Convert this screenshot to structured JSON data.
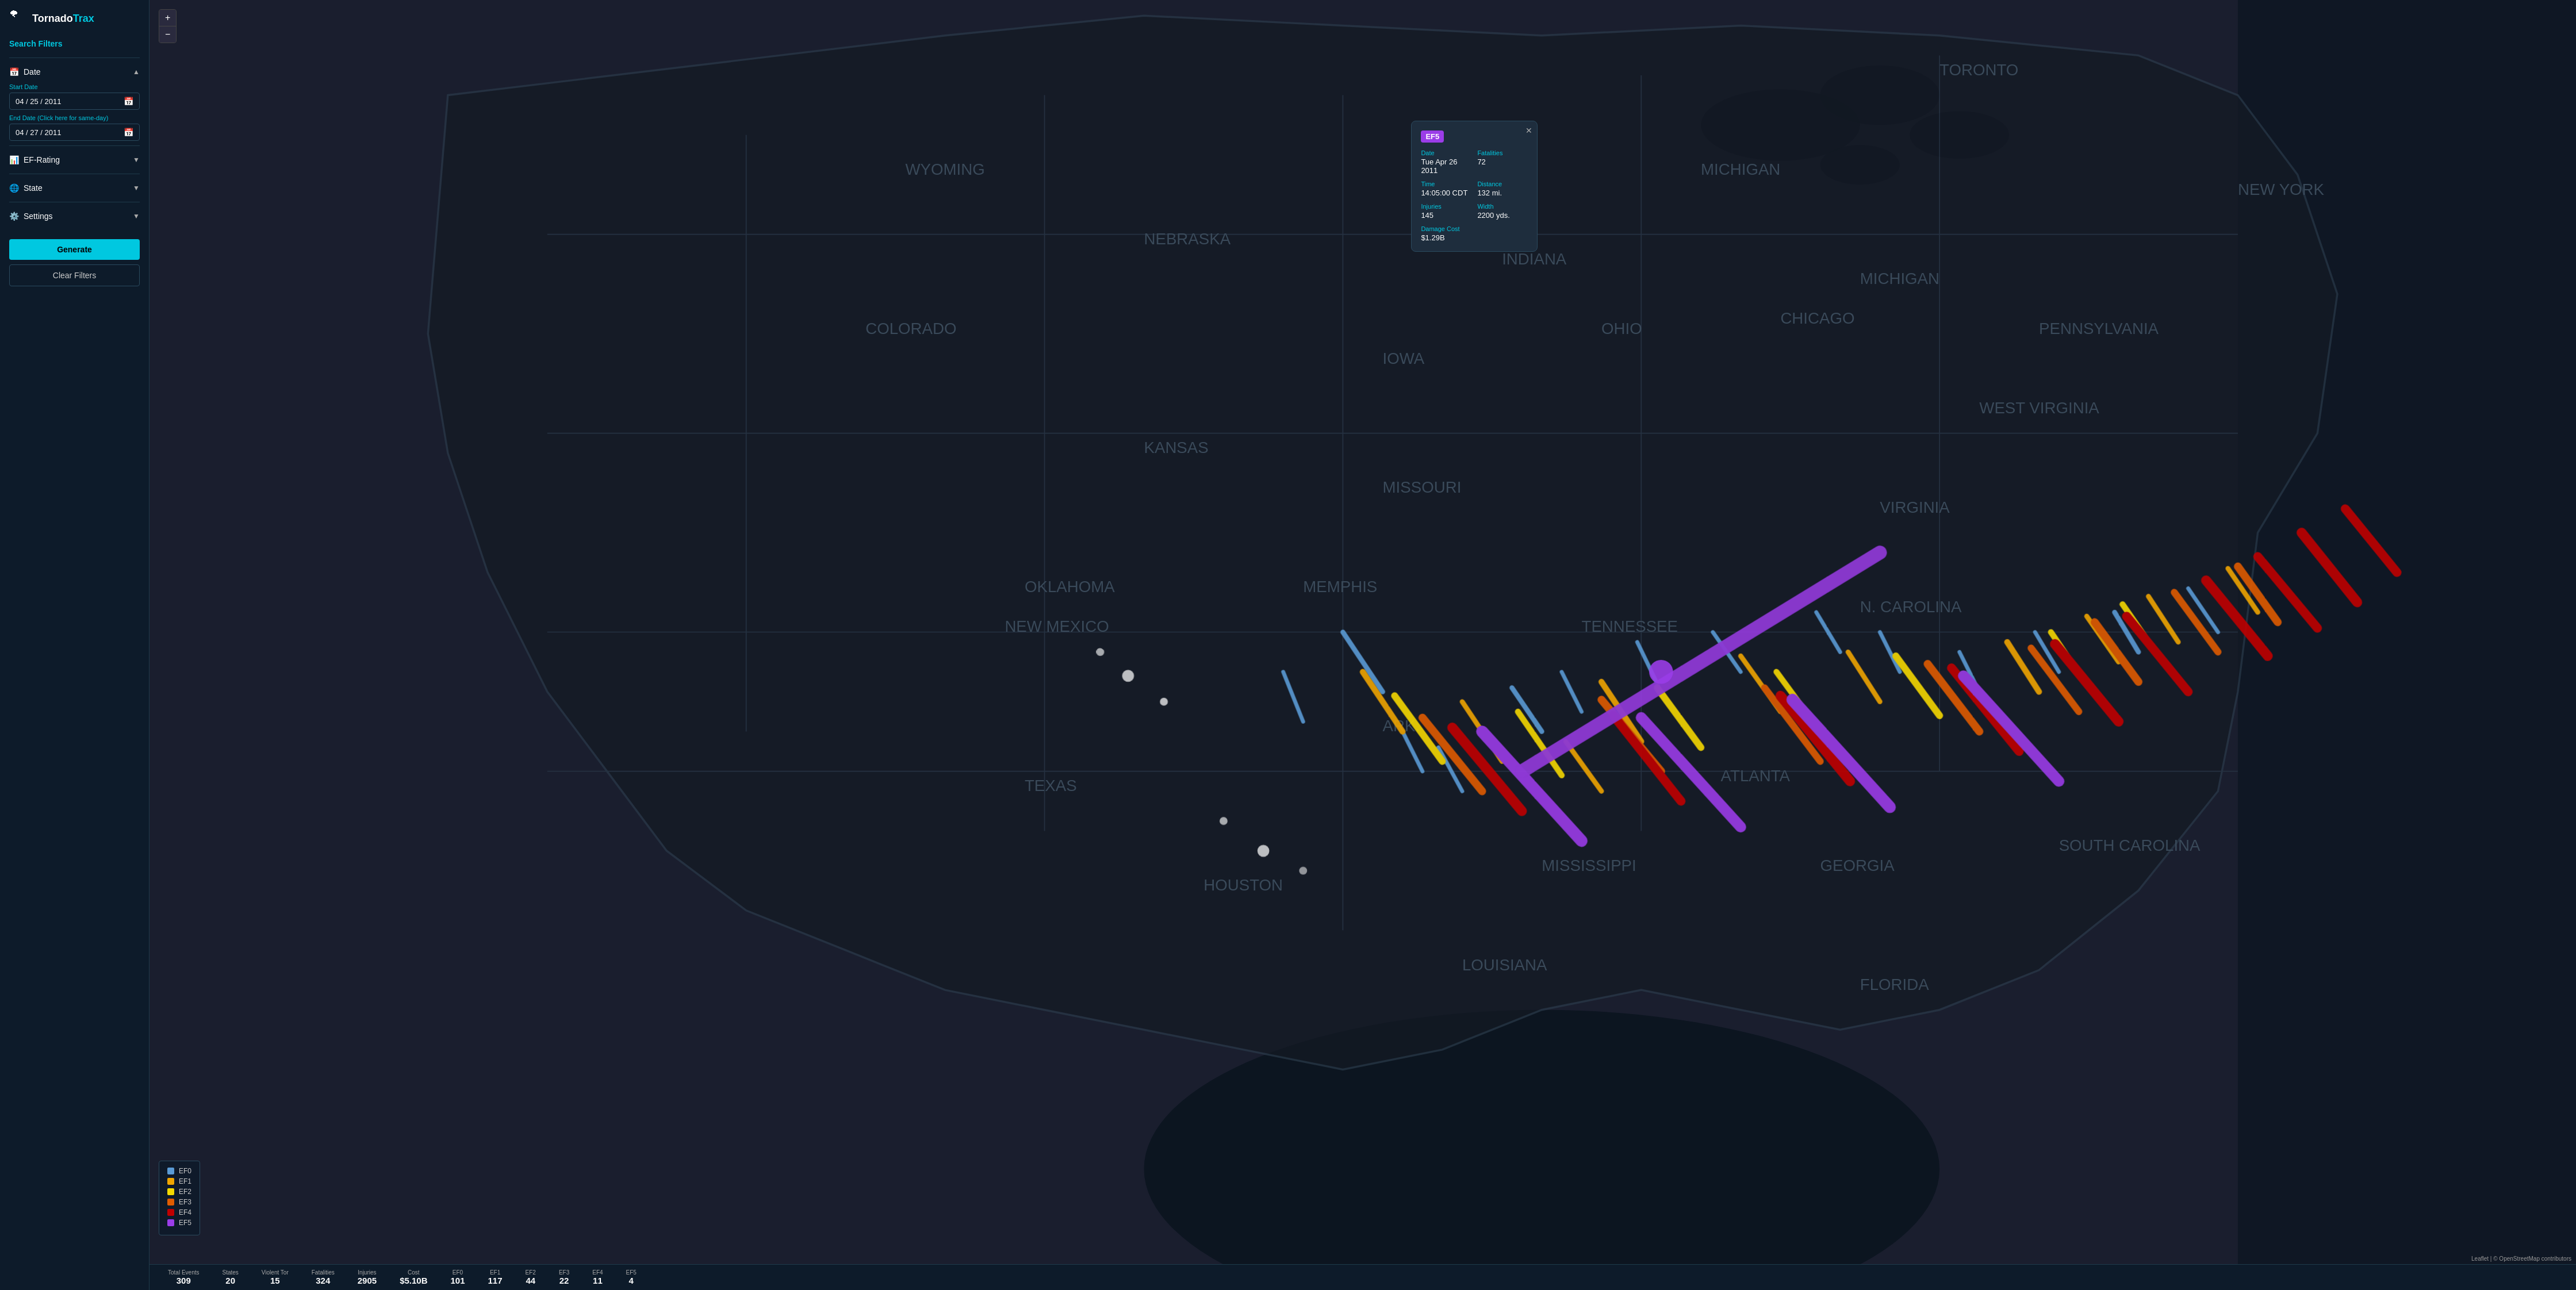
{
  "app": {
    "logo_tornado": "Tornado",
    "logo_trax": "Trax",
    "logo_icon": "🌪"
  },
  "sidebar": {
    "search_filters_title": "Search Filters",
    "date_section": {
      "label": "Date",
      "start_date_label": "Start Date",
      "start_date_value": "04 / 25 / 2011",
      "end_date_label": "End Date (Click here for same-day)",
      "end_date_value": "04 / 27 / 2011"
    },
    "ef_rating": {
      "label": "EF-Rating"
    },
    "state": {
      "label": "State"
    },
    "settings": {
      "label": "Settings"
    },
    "generate_btn": "Generate",
    "clear_btn": "Clear Filters"
  },
  "popup": {
    "ef_badge": "EF5",
    "date_label": "Date",
    "date_value": "Tue Apr 26 2011",
    "time_label": "Time",
    "time_value": "14:05:00 CDT",
    "fatalities_label": "Fatalities",
    "fatalities_value": "72",
    "injuries_label": "Injuries",
    "injuries_value": "145",
    "distance_label": "Distance",
    "distance_value": "132 mi.",
    "width_label": "Width",
    "width_value": "2200 yds.",
    "damage_cost_label": "Damage Cost",
    "damage_cost_value": "$1.29B"
  },
  "legend": {
    "items": [
      {
        "label": "EF0",
        "color": "#5b9bd5"
      },
      {
        "label": "EF1",
        "color": "#f0a500"
      },
      {
        "label": "EF2",
        "color": "#f5d800"
      },
      {
        "label": "EF3",
        "color": "#e05c00"
      },
      {
        "label": "EF4",
        "color": "#c00000"
      },
      {
        "label": "EF5",
        "color": "#9b3de8"
      }
    ]
  },
  "stats": {
    "items": [
      {
        "label": "Total Events",
        "value": "309"
      },
      {
        "label": "States",
        "value": "20"
      },
      {
        "label": "Violent Tor",
        "value": "15"
      },
      {
        "label": "Fatalities",
        "value": "324"
      },
      {
        "label": "Injuries",
        "value": "2905"
      },
      {
        "label": "Cost",
        "value": "$5.10B"
      },
      {
        "label": "EF0",
        "value": "101"
      },
      {
        "label": "EF1",
        "value": "117"
      },
      {
        "label": "EF2",
        "value": "44"
      },
      {
        "label": "EF3",
        "value": "22"
      },
      {
        "label": "EF4",
        "value": "11"
      },
      {
        "label": "EF5",
        "value": "4"
      }
    ]
  },
  "zoom": {
    "plus": "+",
    "minus": "−"
  },
  "attribution": "Leaflet | © OpenStreetMap contributors"
}
